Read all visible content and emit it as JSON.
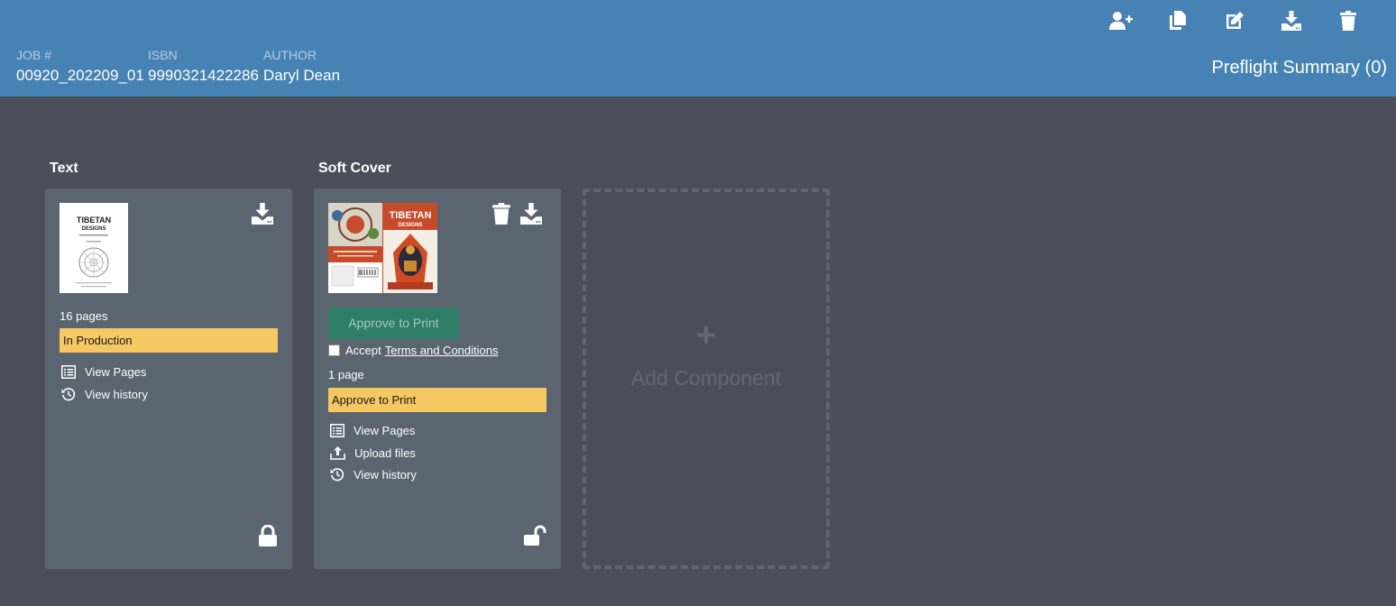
{
  "header": {
    "job_label": "JOB #",
    "job_value": "00920_202209_01",
    "isbn_label": "ISBN",
    "isbn_value": "9990321422286",
    "author_label": "AUTHOR",
    "author_value": "Daryl Dean",
    "preflight": "Preflight Summary (0)",
    "toolbar_icons": [
      "add-user-icon",
      "copy-icon",
      "edit-icon",
      "download-icon",
      "trash-icon"
    ]
  },
  "components": {
    "text": {
      "title": "Text",
      "thumb_title": "TIBETAN DESIGNS",
      "pages": "16 pages",
      "status": "In Production",
      "view_pages": "View Pages",
      "view_history": "View history",
      "locked": true
    },
    "softcover": {
      "title": "Soft Cover",
      "thumb_title": "TIBETAN DESIGNS",
      "approve_button": "Approve to Print",
      "accept_prefix": "Accept",
      "terms": "Terms and Conditions",
      "pages": "1 page",
      "status": "Approve to Print",
      "view_pages": "View Pages",
      "upload_files": "Upload files",
      "view_history": "View history",
      "locked": false
    },
    "add": {
      "plus": "+",
      "label": "Add Component"
    }
  },
  "colors": {
    "header": "#4682b4",
    "background": "#4a4e58",
    "card": "#5a6570",
    "status": "#f5c862",
    "approve": "#2e7d67"
  }
}
